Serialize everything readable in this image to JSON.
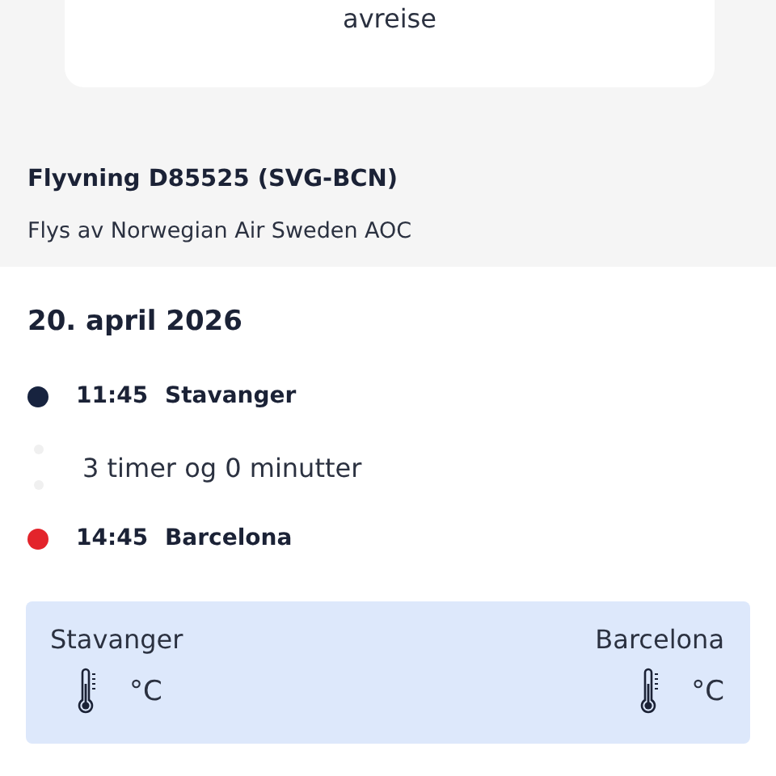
{
  "card": {
    "text": "avreise"
  },
  "flight": {
    "title": "Flyvning D85525 (SVG-BCN)",
    "operator": "Flys av Norwegian Air Sweden AOC"
  },
  "date": "20. april 2026",
  "timeline": [
    {
      "kind": "stop",
      "time": "11:45",
      "place": "Stavanger",
      "color": "#17233f"
    },
    {
      "kind": "duration",
      "text": "3 timer og 0 minutter"
    },
    {
      "kind": "stop",
      "time": "14:45",
      "place": "Barcelona",
      "color": "#e3242b"
    }
  ],
  "weather": [
    {
      "city": "Stavanger",
      "unit": "°C"
    },
    {
      "city": "Barcelona",
      "unit": "°C"
    }
  ]
}
